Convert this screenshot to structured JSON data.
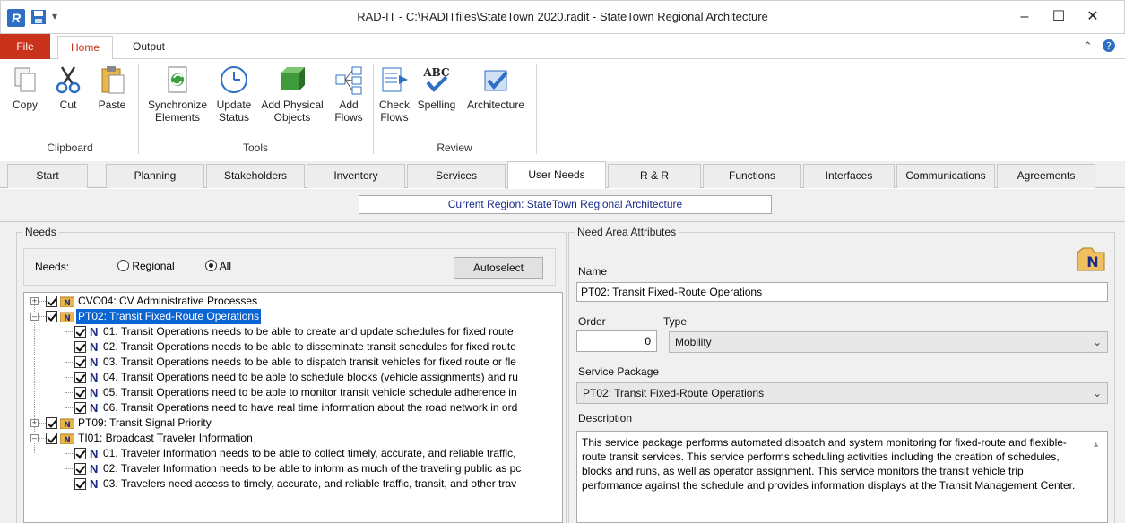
{
  "window": {
    "title": "RAD-IT - C:\\RADITfiles\\StateTown 2020.radit - StateTown Regional Architecture",
    "app_icon_letter": "R",
    "minimize": "–",
    "maximize": "☐",
    "close": "✕"
  },
  "ribbon_tabs": {
    "file": "File",
    "home": "Home",
    "output": "Output"
  },
  "ribbon": {
    "clipboard": {
      "label": "Clipboard",
      "copy": "Copy",
      "cut": "Cut",
      "paste": "Paste"
    },
    "tools": {
      "label": "Tools",
      "sync_1": "Synchronize",
      "sync_2": "Elements",
      "update_1": "Update",
      "update_2": "Status",
      "addphys_1": "Add Physical",
      "addphys_2": "Objects",
      "addflows_1": "Add",
      "addflows_2": "Flows"
    },
    "review": {
      "label": "Review",
      "check_1": "Check",
      "check_2": "Flows",
      "spelling": "Spelling",
      "architecture": "Architecture",
      "abc": "ABC"
    }
  },
  "main_tabs": [
    "Start",
    "Planning",
    "Stakeholders",
    "Inventory",
    "Services",
    "User Needs",
    "R & R",
    "Functions",
    "Interfaces",
    "Communications",
    "Agreements"
  ],
  "active_tab": "User Needs",
  "current_region": "Current Region: StateTown Regional Architecture",
  "needs": {
    "group_label": "Needs",
    "needs_label": "Needs:",
    "regional": "Regional",
    "all": "All",
    "autoselect": "Autoselect",
    "tree": [
      {
        "kind": "area",
        "text": "CVO04: CV Administrative Processes",
        "expanded": false
      },
      {
        "kind": "area",
        "text": "PT02: Transit Fixed-Route Operations",
        "expanded": true,
        "selected": true
      },
      {
        "kind": "need",
        "text": "01. Transit Operations needs to be able to create and update schedules for fixed route"
      },
      {
        "kind": "need",
        "text": "02. Transit Operations needs to be able to disseminate transit schedules for fixed route"
      },
      {
        "kind": "need",
        "text": "03. Transit Operations needs to be able to dispatch transit vehicles for fixed route or fle"
      },
      {
        "kind": "need",
        "text": "04. Transit Operations need to be able to schedule blocks (vehicle assignments) and ru"
      },
      {
        "kind": "need",
        "text": "05. Transit Operations need to be able to monitor transit vehicle schedule adherence in"
      },
      {
        "kind": "need",
        "text": "06. Transit Operations need to have real time information about the road network in ord"
      },
      {
        "kind": "area",
        "text": "PT09: Transit Signal Priority",
        "expanded": false
      },
      {
        "kind": "area",
        "text": "TI01: Broadcast Traveler Information",
        "expanded": true
      },
      {
        "kind": "need",
        "text": "01. Traveler Information needs to be able to collect timely, accurate, and reliable traffic,"
      },
      {
        "kind": "need",
        "text": "02. Traveler Information needs to be able to inform as much of the traveling public as pc"
      },
      {
        "kind": "need",
        "text": "03. Travelers need access to timely, accurate, and reliable traffic, transit, and other trav"
      }
    ]
  },
  "attributes": {
    "group_label": "Need Area Attributes",
    "name_label": "Name",
    "name_value": "PT02: Transit Fixed-Route Operations",
    "order_label": "Order",
    "order_value": "0",
    "type_label": "Type",
    "type_value": "Mobility",
    "service_label": "Service Package",
    "service_value": "PT02: Transit Fixed-Route Operations",
    "description_label": "Description",
    "description": "This service package performs automated dispatch and system monitoring for fixed-route and flexible-route transit services.  This service performs scheduling activities including the creation of schedules, blocks and runs, as well as operator assignment.  This service monitors the transit vehicle trip performance against the schedule and provides information displays at the Transit Management Center."
  },
  "colors": {
    "file_tab": "#c9331b",
    "selection": "#0a64d2",
    "region_text": "#1a2b8a"
  }
}
